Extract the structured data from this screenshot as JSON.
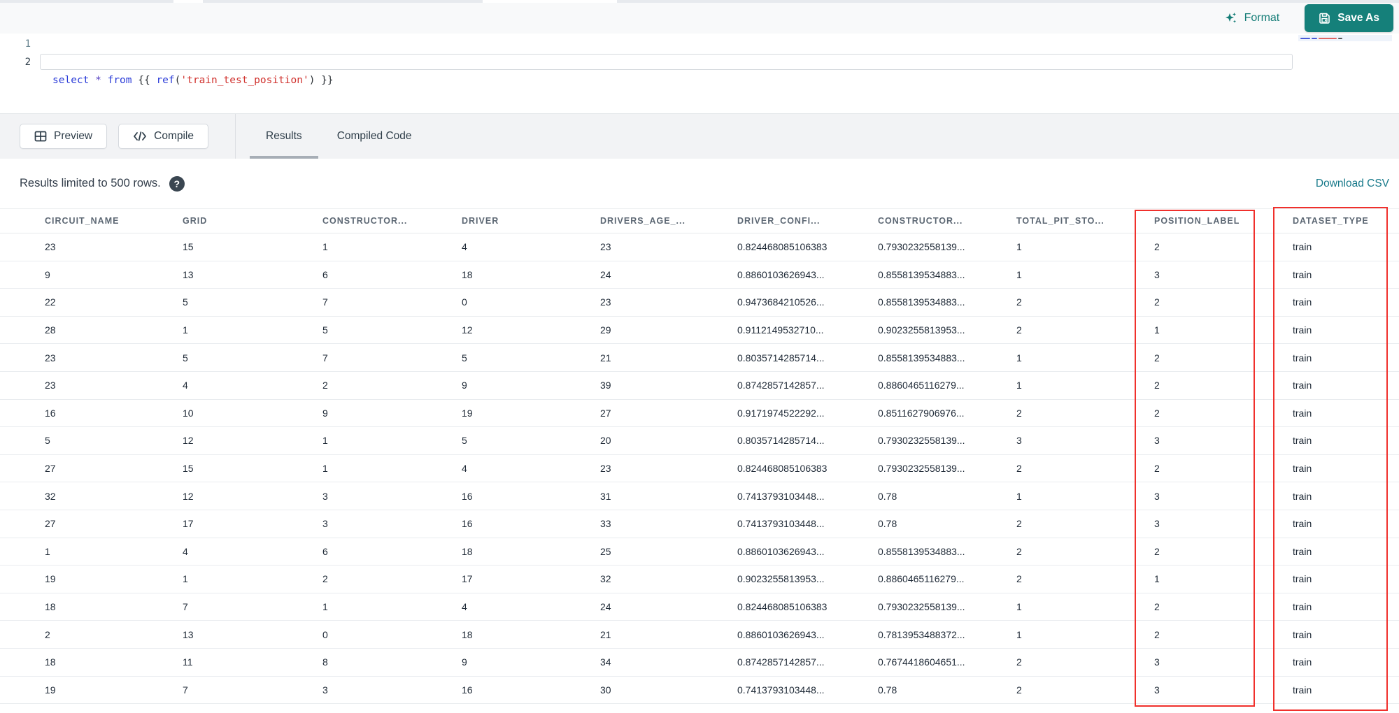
{
  "editor": {
    "lines": [
      {
        "number": "1",
        "tokens": [
          {
            "t": "select",
            "c": "kw"
          },
          {
            "t": " ",
            "c": "plain"
          },
          {
            "t": "*",
            "c": "star"
          },
          {
            "t": " ",
            "c": "plain"
          },
          {
            "t": "from",
            "c": "kw"
          },
          {
            "t": " ",
            "c": "plain"
          },
          {
            "t": "{{ ",
            "c": "brace"
          },
          {
            "t": "ref",
            "c": "fn"
          },
          {
            "t": "(",
            "c": "brace"
          },
          {
            "t": "'train_test_position'",
            "c": "str"
          },
          {
            "t": ")",
            "c": "brace"
          },
          {
            "t": " }}",
            "c": "brace"
          }
        ]
      },
      {
        "number": "2",
        "tokens": []
      }
    ]
  },
  "toolbar": {
    "format_label": "Format",
    "save_as_label": "Save As",
    "preview_label": "Preview",
    "compile_label": "Compile"
  },
  "tabs": [
    {
      "label": "Results",
      "active": true
    },
    {
      "label": "Compiled Code",
      "active": false
    }
  ],
  "results_bar": {
    "message": "Results limited to 500 rows.",
    "help_glyph": "?",
    "download_label": "Download CSV"
  },
  "table": {
    "columns": [
      "CIRCUIT_NAME",
      "GRID",
      "CONSTRUCTOR...",
      "DRIVER",
      "DRIVERS_AGE_...",
      "DRIVER_CONFI...",
      "CONSTRUCTOR...",
      "TOTAL_PIT_STO...",
      "POSITION_LABEL",
      "DATASET_TYPE"
    ],
    "rows": [
      [
        "23",
        "15",
        "1",
        "4",
        "23",
        "0.824468085106383",
        "0.7930232558139...",
        "1",
        "2",
        "train"
      ],
      [
        "9",
        "13",
        "6",
        "18",
        "24",
        "0.8860103626943...",
        "0.8558139534883...",
        "1",
        "3",
        "train"
      ],
      [
        "22",
        "5",
        "7",
        "0",
        "23",
        "0.9473684210526...",
        "0.8558139534883...",
        "2",
        "2",
        "train"
      ],
      [
        "28",
        "1",
        "5",
        "12",
        "29",
        "0.9112149532710...",
        "0.9023255813953...",
        "2",
        "1",
        "train"
      ],
      [
        "23",
        "5",
        "7",
        "5",
        "21",
        "0.8035714285714...",
        "0.8558139534883...",
        "1",
        "2",
        "train"
      ],
      [
        "23",
        "4",
        "2",
        "9",
        "39",
        "0.8742857142857...",
        "0.8860465116279...",
        "1",
        "2",
        "train"
      ],
      [
        "16",
        "10",
        "9",
        "19",
        "27",
        "0.9171974522292...",
        "0.8511627906976...",
        "2",
        "2",
        "train"
      ],
      [
        "5",
        "12",
        "1",
        "5",
        "20",
        "0.8035714285714...",
        "0.7930232558139...",
        "3",
        "3",
        "train"
      ],
      [
        "27",
        "15",
        "1",
        "4",
        "23",
        "0.824468085106383",
        "0.7930232558139...",
        "2",
        "2",
        "train"
      ],
      [
        "32",
        "12",
        "3",
        "16",
        "31",
        "0.7413793103448...",
        "0.78",
        "1",
        "3",
        "train"
      ],
      [
        "27",
        "17",
        "3",
        "16",
        "33",
        "0.7413793103448...",
        "0.78",
        "2",
        "3",
        "train"
      ],
      [
        "1",
        "4",
        "6",
        "18",
        "25",
        "0.8860103626943...",
        "0.8558139534883...",
        "2",
        "2",
        "train"
      ],
      [
        "19",
        "1",
        "2",
        "17",
        "32",
        "0.9023255813953...",
        "0.8860465116279...",
        "2",
        "1",
        "train"
      ],
      [
        "18",
        "7",
        "1",
        "4",
        "24",
        "0.824468085106383",
        "0.7930232558139...",
        "1",
        "2",
        "train"
      ],
      [
        "2",
        "13",
        "0",
        "18",
        "21",
        "0.8860103626943...",
        "0.7813953488372...",
        "1",
        "2",
        "train"
      ],
      [
        "18",
        "11",
        "8",
        "9",
        "34",
        "0.8742857142857...",
        "0.7674418604651...",
        "2",
        "3",
        "train"
      ],
      [
        "19",
        "7",
        "3",
        "16",
        "30",
        "0.7413793103448...",
        "0.78",
        "2",
        "3",
        "train"
      ]
    ]
  },
  "annotations": {
    "highlighted_columns": [
      "POSITION_LABEL",
      "DATASET_TYPE"
    ],
    "highlight_color": "#f0302c"
  },
  "colors": {
    "accent_teal": "#15807a",
    "format_teal": "#157d77",
    "link_teal": "#17798a",
    "keyword_blue": "#2a3bd8",
    "string_red": "#d0312d",
    "tab_underline": "#a7aeb6"
  }
}
